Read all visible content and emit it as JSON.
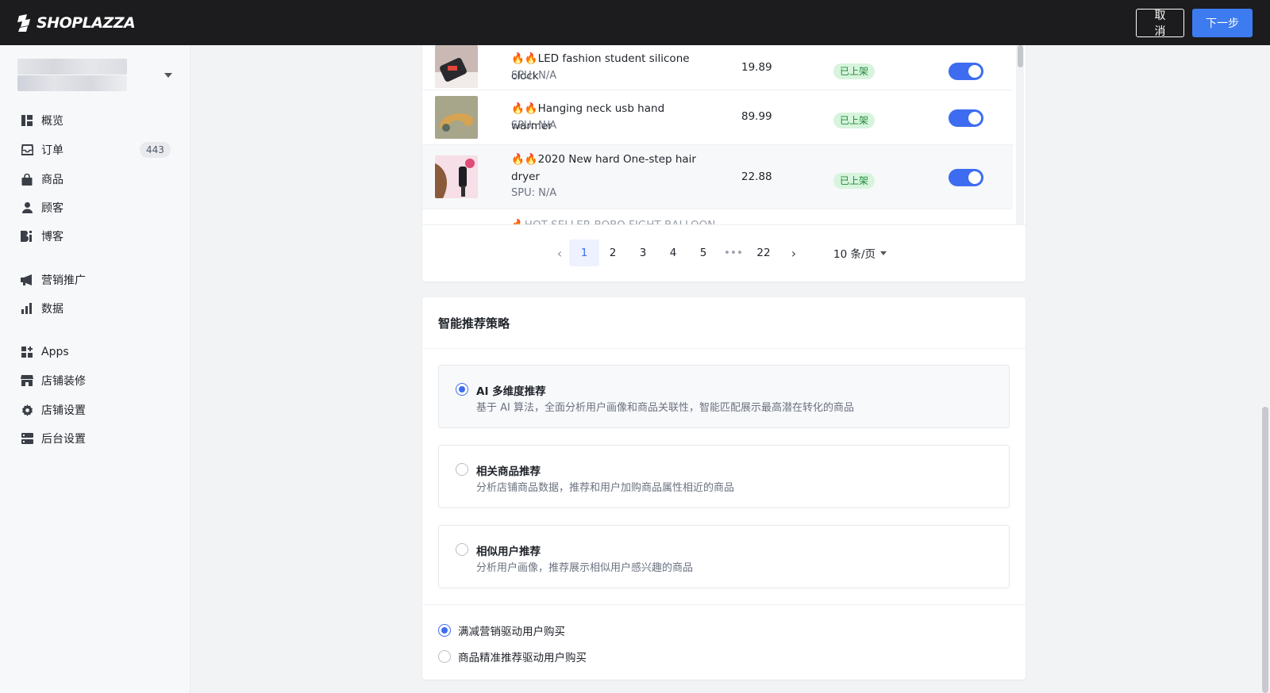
{
  "app": {
    "brand": "SHOPLAZZA"
  },
  "topbar": {
    "cancel_label": "取消",
    "next_label": "下一步"
  },
  "sidebar": {
    "items": [
      {
        "key": "overview",
        "label": "概览",
        "icon": "dashboard-icon"
      },
      {
        "key": "orders",
        "label": "订单",
        "icon": "inbox-icon",
        "badge": "443"
      },
      {
        "key": "products",
        "label": "商品",
        "icon": "bag-icon"
      },
      {
        "key": "customers",
        "label": "顾客",
        "icon": "user-icon"
      },
      {
        "key": "blog",
        "label": "博客",
        "icon": "blog-icon"
      },
      {
        "key": "marketing",
        "label": "营销推广",
        "icon": "megaphone-icon"
      },
      {
        "key": "analytics",
        "label": "数据",
        "icon": "bar-chart-icon"
      },
      {
        "key": "apps",
        "label": "Apps",
        "icon": "apps-icon"
      },
      {
        "key": "theme",
        "label": "店铺装修",
        "icon": "store-icon"
      },
      {
        "key": "store_settings",
        "label": "店铺设置",
        "icon": "gear-icon"
      },
      {
        "key": "admin_settings",
        "label": "后台设置",
        "icon": "server-icon"
      }
    ]
  },
  "products": {
    "rows": [
      {
        "title": "🔥🔥LED fashion student silicone clock",
        "spu": "SPU: N/A",
        "price": "19.89",
        "status": "已上架",
        "enabled": true
      },
      {
        "title": "🔥🔥Hanging neck usb hand warmer",
        "spu": "SPU: N/A",
        "price": "89.99",
        "status": "已上架",
        "enabled": true
      },
      {
        "title": "🔥🔥2020 New hard One-step hair dryer",
        "spu": "SPU: N/A",
        "price": "22.88",
        "status": "已上架",
        "enabled": true
      },
      {
        "title": "🔥HOT SELLER BOBO FIGHT BALLOON",
        "spu": "",
        "price": "",
        "status": "",
        "enabled": true
      }
    ]
  },
  "pagination": {
    "pages": [
      "1",
      "2",
      "3",
      "4",
      "5",
      "•••",
      "22"
    ],
    "current": "1",
    "page_size": "10 条/页"
  },
  "strategy": {
    "title": "智能推荐策略",
    "options": [
      {
        "title": "AI 多维度推荐",
        "desc": "基于 AI 算法，全面分析用户画像和商品关联性，智能匹配展示最高潜在转化的商品",
        "selected": true
      },
      {
        "title": "相关商品推荐",
        "desc": "分析店铺商品数据，推荐和用户加购商品属性相近的商品",
        "selected": false
      },
      {
        "title": "相似用户推荐",
        "desc": "分析用户画像，推荐展示相似用户感兴趣的商品",
        "selected": false
      }
    ],
    "drivers": [
      {
        "label": "满减营销驱动用户购买",
        "selected": true
      },
      {
        "label": "商品精准推荐驱动用户购买",
        "selected": false
      }
    ]
  },
  "colors": {
    "accent": "#3d6cf0",
    "topbar": "#1c1c1e",
    "status_bg": "#d7f4dd",
    "status_text": "#1f8a3a"
  }
}
